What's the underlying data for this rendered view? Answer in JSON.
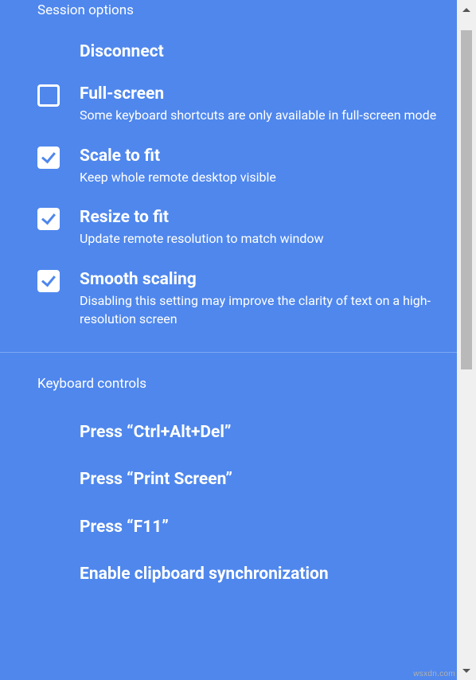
{
  "sessionOptions": {
    "header": "Session options",
    "disconnect": "Disconnect",
    "fullscreen": {
      "title": "Full-screen",
      "desc": "Some keyboard shortcuts are only available in full-screen mode",
      "checked": false
    },
    "scaleToFit": {
      "title": "Scale to fit",
      "desc": "Keep whole remote desktop visible",
      "checked": true
    },
    "resizeToFit": {
      "title": "Resize to fit",
      "desc": "Update remote resolution to match window",
      "checked": true
    },
    "smoothScaling": {
      "title": "Smooth scaling",
      "desc": "Disabling this setting may improve the clarity of text on a high-resolution screen",
      "checked": true
    }
  },
  "keyboardControls": {
    "header": "Keyboard controls",
    "ctrlAltDel": "Press “Ctrl+Alt+Del”",
    "printScreen": "Press “Print Screen”",
    "f11": "Press “F11”",
    "clipboard": "Enable clipboard synchronization"
  },
  "watermark": "wsxdn.com"
}
